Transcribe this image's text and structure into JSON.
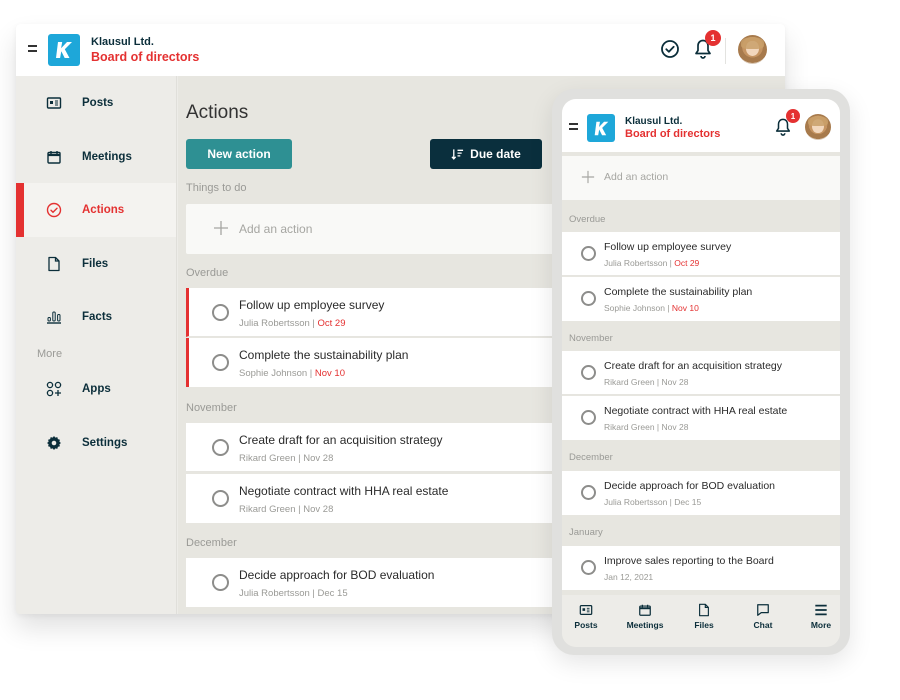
{
  "brand": {
    "company": "Klausul Ltd.",
    "board": "Board of directors",
    "logo_letter": "K",
    "accent": "#e43131",
    "logo_color": "#1ea7d9",
    "primary_button_color": "#2e9093",
    "dark_button_color": "#0a2f3d"
  },
  "desktop": {
    "topbar": {
      "notification_count": "1"
    },
    "sidebar": {
      "items": [
        {
          "label": "Posts",
          "icon": "newspaper-icon"
        },
        {
          "label": "Meetings",
          "icon": "calendar-icon"
        },
        {
          "label": "Actions",
          "icon": "check-circle-icon",
          "active": true
        },
        {
          "label": "Files",
          "icon": "file-icon"
        },
        {
          "label": "Facts",
          "icon": "bar-chart-icon"
        }
      ],
      "more_label": "More",
      "more_items": [
        {
          "label": "Apps",
          "icon": "apps-grid-icon"
        },
        {
          "label": "Settings",
          "icon": "gear-icon"
        }
      ]
    },
    "main": {
      "title": "Actions",
      "new_action_label": "New action",
      "sort_label": "Due date",
      "things_to_do_label": "Things to do",
      "add_placeholder": "Add an action",
      "sections": [
        {
          "label": "Overdue",
          "tasks": [
            {
              "title": "Follow up employee survey",
              "assignee": "Julia Robertsson",
              "due": "Oct 29",
              "overdue": true
            },
            {
              "title": "Complete the sustainability plan",
              "assignee": "Sophie Johnson",
              "due": "Nov 10",
              "overdue": true
            }
          ]
        },
        {
          "label": "November",
          "tasks": [
            {
              "title": "Create draft for an acquisition strategy",
              "assignee": "Rikard Green",
              "due": "Nov 28"
            },
            {
              "title": "Negotiate contract with HHA real estate",
              "assignee": "Rikard Green",
              "due": "Nov 28"
            }
          ]
        },
        {
          "label": "December",
          "tasks": [
            {
              "title": "Decide approach for BOD evaluation",
              "assignee": "Julia Robertsson",
              "due": "Dec 15"
            }
          ]
        }
      ]
    }
  },
  "mobile": {
    "notification_count": "1",
    "add_placeholder": "Add an action",
    "sections": [
      {
        "label": "Overdue",
        "tasks": [
          {
            "title": "Follow up employee survey",
            "assignee": "Julia Robertsson",
            "due": "Oct 29",
            "overdue": true
          },
          {
            "title": "Complete the sustainability plan",
            "assignee": "Sophie Johnson",
            "due": "Nov 10",
            "overdue": true
          }
        ]
      },
      {
        "label": "November",
        "tasks": [
          {
            "title": "Create draft for an acquisition strategy",
            "assignee": "Rikard Green",
            "due": "Nov 28"
          },
          {
            "title": "Negotiate contract with HHA real estate",
            "assignee": "Rikard Green",
            "due": "Nov 28"
          }
        ]
      },
      {
        "label": "December",
        "tasks": [
          {
            "title": "Decide approach for BOD evaluation",
            "assignee": "Julia Robertsson",
            "due": "Dec 15"
          }
        ]
      },
      {
        "label": "January",
        "tasks": [
          {
            "title": "Improve sales reporting to the Board",
            "assignee": "",
            "due": "Jan 12, 2021"
          }
        ]
      }
    ],
    "tabbar": [
      {
        "label": "Posts",
        "icon": "newspaper-icon"
      },
      {
        "label": "Meetings",
        "icon": "calendar-icon"
      },
      {
        "label": "Files",
        "icon": "file-icon"
      },
      {
        "label": "Chat",
        "icon": "chat-bubble-icon"
      },
      {
        "label": "More",
        "icon": "menu-icon"
      }
    ]
  }
}
